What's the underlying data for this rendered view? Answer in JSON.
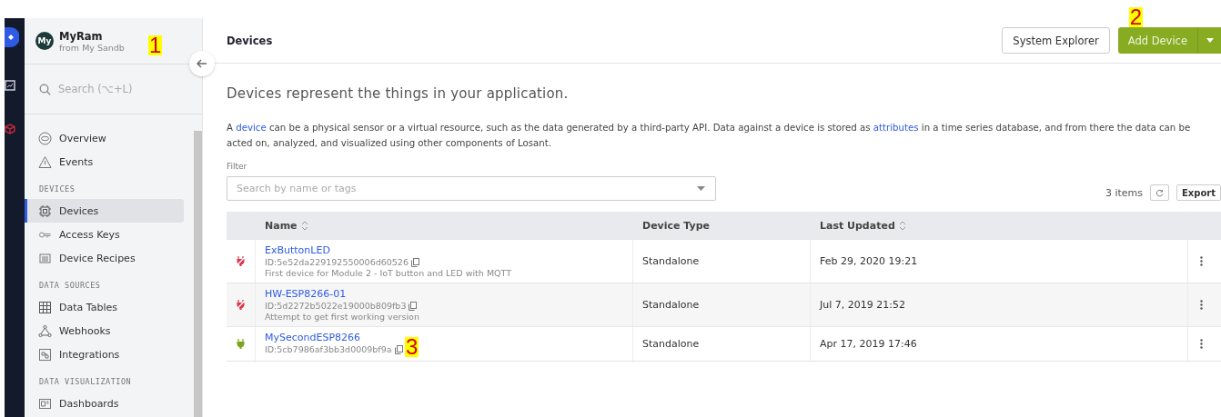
{
  "app_rail": {
    "items": [
      {
        "kind": "logo"
      },
      {
        "kind": "dashboard"
      },
      {
        "kind": "box"
      }
    ]
  },
  "sidebar": {
    "org": {
      "avatar": "My",
      "name": "MyRam",
      "subtitle": "from My Sandb"
    },
    "search": {
      "placeholder": "Search (⌥+L)"
    },
    "sections": [
      {
        "items": [
          {
            "label": "Overview",
            "selected": false
          },
          {
            "label": "Events",
            "selected": false
          }
        ]
      },
      {
        "heading": "DEVICES",
        "items": [
          {
            "label": "Devices",
            "selected": true
          },
          {
            "label": "Access Keys",
            "selected": false
          },
          {
            "label": "Device Recipes",
            "selected": false
          }
        ]
      },
      {
        "heading": "DATA SOURCES",
        "items": [
          {
            "label": "Data Tables",
            "selected": false
          },
          {
            "label": "Webhooks",
            "selected": false
          },
          {
            "label": "Integrations",
            "selected": false
          }
        ]
      },
      {
        "heading": "DATA VISUALIZATION",
        "items": [
          {
            "label": "Dashboards",
            "selected": false
          }
        ]
      }
    ]
  },
  "header": {
    "title": "Devices",
    "buttons": [
      {
        "label": "System Explorer",
        "kind": "secondary"
      },
      {
        "label": "Add Device",
        "kind": "primary"
      }
    ]
  },
  "intro": {
    "heading": "Devices represent the things in your application.",
    "paragraph": [
      {
        "text": "A "
      },
      {
        "text": "device",
        "link": true
      },
      {
        "text": " can be a physical sensor or a virtual resource, such as the data generated by a third-party API. Data against a device is stored as "
      },
      {
        "text": "attributes",
        "link": true
      },
      {
        "text": " in a time series database, and from there the data can be acted on, analyzed, and visualized using other components of Losant."
      }
    ]
  },
  "filter": {
    "label": "Filter",
    "placeholder": "Search by name or tags"
  },
  "toolbar": {
    "count": "3 items",
    "export": "Export"
  },
  "table": {
    "columns": [
      {
        "label": "Name",
        "sortable": true
      },
      {
        "label": "Device Type",
        "sortable": false
      },
      {
        "label": "Last Updated",
        "sortable": true
      }
    ],
    "rows": [
      {
        "connected": false,
        "name": "ExButtonLED",
        "id": "ID:5e52da229192550006d60526",
        "description": "First device for Module 2 - IoT button and LED with MQTT",
        "type": "Standalone",
        "updated": "Feb 29, 2020 19:21"
      },
      {
        "connected": false,
        "name": "HW-ESP8266-01",
        "id": "ID:5d2272b5022e19000b809fb3",
        "description": "Attempt to get first working version",
        "type": "Standalone",
        "updated": "Jul 7, 2019 21:52"
      },
      {
        "connected": true,
        "name": "MySecondESP8266",
        "id": "ID:5cb7986af3bb3d0009bf9a",
        "type": "Standalone",
        "updated": "Apr 17, 2019 17:46"
      }
    ]
  },
  "annotations": [
    "1",
    "2",
    "3"
  ]
}
